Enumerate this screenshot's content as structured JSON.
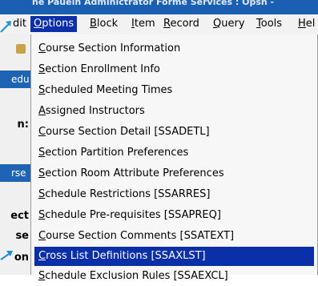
{
  "window_title": "ne Pauein Adminictrator Forme Services : Opsn -",
  "menubar": {
    "items": [
      {
        "label": "dit",
        "mnemonic": "",
        "rest": "dit"
      },
      {
        "label": "Options",
        "mnemonic": "O",
        "rest": "ptions"
      },
      {
        "label": "Block",
        "mnemonic": "B",
        "rest": "lock"
      },
      {
        "label": "Item",
        "mnemonic": "I",
        "rest": "tem"
      },
      {
        "label": "Record",
        "mnemonic": "R",
        "rest": "ecord"
      },
      {
        "label": "Query",
        "mnemonic": "Q",
        "rest": "uery"
      },
      {
        "label": "Tools",
        "mnemonic": "T",
        "rest": "ools"
      },
      {
        "label": "Hel",
        "mnemonic": "H",
        "rest": "el"
      }
    ]
  },
  "background": {
    "chip1": "edu",
    "label_n": "n:",
    "chip2": "rse",
    "label_ect": "ect",
    "label_se": "se",
    "label_on": "on"
  },
  "options_menu": {
    "items": [
      {
        "mnemonic": "C",
        "rest": "ourse Section Information"
      },
      {
        "mnemonic": "S",
        "rest": "ection Enrollment Info"
      },
      {
        "mnemonic": "S",
        "rest": "cheduled Meeting Times"
      },
      {
        "mnemonic": "A",
        "rest": "ssigned Instructors"
      },
      {
        "mnemonic": "C",
        "rest": "ourse Section Detail [SSADETL]"
      },
      {
        "mnemonic": "S",
        "rest": "ection Partition Preferences"
      },
      {
        "mnemonic": "S",
        "rest": "ection Room Attribute Preferences"
      },
      {
        "mnemonic": "S",
        "rest": "chedule Restrictions [SSARRES]"
      },
      {
        "mnemonic": "S",
        "rest": "chedule Pre-requisites [SSAPREQ]"
      },
      {
        "mnemonic": "C",
        "rest": "ourse Section Comments [SSATEXT]"
      },
      {
        "mnemonic": "C",
        "rest": "ross List Definitions [SSAXLST]"
      },
      {
        "mnemonic": "S",
        "rest": "chedule Exclusion Rules [SSAEXCL]"
      }
    ],
    "selected_index": 10
  },
  "colors": {
    "selection": "#0b2fa8",
    "title_bar": "#1b5fb2",
    "annotation_arrow": "#1f8fd6"
  }
}
